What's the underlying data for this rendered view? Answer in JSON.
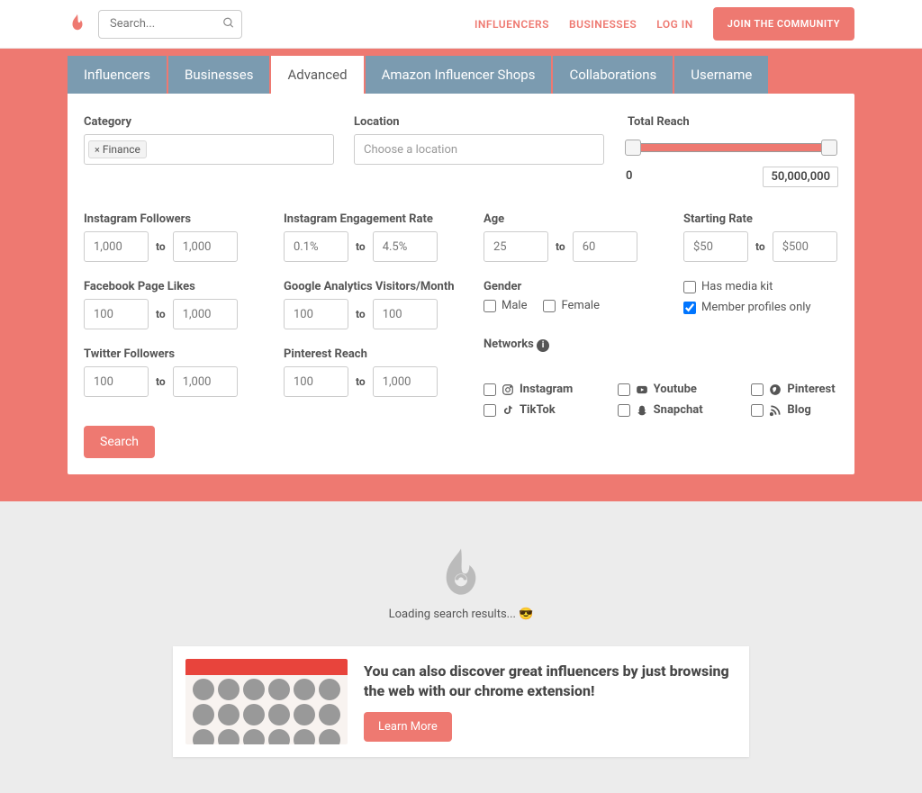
{
  "header": {
    "search_placeholder": "Search...",
    "nav": {
      "influencers": "INFLUENCERS",
      "businesses": "BUSINESSES",
      "login": "LOG IN"
    },
    "join_btn": "JOIN THE COMMUNITY"
  },
  "tabs": {
    "influencers": "Influencers",
    "businesses": "Businesses",
    "advanced": "Advanced",
    "amazon": "Amazon Influencer Shops",
    "collaborations": "Collaborations",
    "username": "Username"
  },
  "form": {
    "category_label": "Category",
    "category_tag": "Finance",
    "location_label": "Location",
    "location_placeholder": "Choose a location",
    "total_reach_label": "Total Reach",
    "total_reach_min": "0",
    "total_reach_max": "50,000,000",
    "ig_followers_label": "Instagram Followers",
    "ig_followers_min_ph": "1,000",
    "ig_followers_max_ph": "1,000",
    "ig_engagement_label": "Instagram Engagement Rate",
    "ig_engagement_min_ph": "0.1%",
    "ig_engagement_max_ph": "4.5%",
    "fb_likes_label": "Facebook Page Likes",
    "fb_likes_min_ph": "100",
    "fb_likes_max_ph": "1,000",
    "ga_label": "Google Analytics Visitors/Month",
    "ga_min_ph": "100",
    "ga_max_ph": "100",
    "tw_label": "Twitter Followers",
    "tw_min_ph": "100",
    "tw_max_ph": "1,000",
    "pin_label": "Pinterest Reach",
    "pin_min_ph": "100",
    "pin_max_ph": "1,000",
    "age_label": "Age",
    "age_min_ph": "25",
    "age_max_ph": "60",
    "rate_label": "Starting Rate",
    "rate_min_ph": "$50",
    "rate_max_ph": "$500",
    "gender_label": "Gender",
    "gender_male": "Male",
    "gender_female": "Female",
    "has_media_kit": "Has media kit",
    "member_only": "Member profiles only",
    "networks_label": "Networks",
    "net_instagram": "Instagram",
    "net_youtube": "Youtube",
    "net_pinterest": "Pinterest",
    "net_tiktok": "TikTok",
    "net_snapchat": "Snapchat",
    "net_blog": "Blog",
    "to": "to",
    "search_btn": "Search"
  },
  "results": {
    "loading_text": "Loading search results... 😎"
  },
  "promo": {
    "title": "You can also discover great influencers by just browsing the web with our chrome extension!",
    "btn": "Learn More"
  }
}
